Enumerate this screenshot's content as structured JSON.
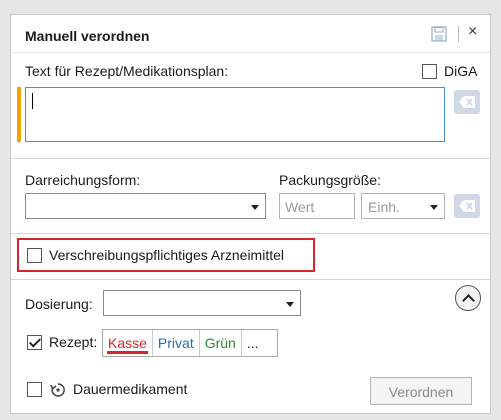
{
  "dialog": {
    "title": "Manuell verordnen",
    "save_icon": "save-icon",
    "close_label": "×"
  },
  "text_section": {
    "label": "Text für Rezept/Medikationsplan:",
    "diga_label": "DiGA",
    "diga_checked": false,
    "text_value": "",
    "clear_icon": "backspace-clear-icon"
  },
  "form_section": {
    "darreichungsform_label": "Darreichungsform:",
    "darreichungsform_value": "",
    "packungsgroesse_label": "Packungsgröße:",
    "wert_placeholder": "Wert",
    "einheit_placeholder": "Einh."
  },
  "prescription_required": {
    "label": "Verschreibungspflichtiges Arzneimittel",
    "checked": false,
    "highlight_color": "#d9262e"
  },
  "dosage": {
    "label": "Dosierung:",
    "value": ""
  },
  "rezept": {
    "label": "Rezept:",
    "checked": true,
    "options": [
      "Kasse",
      "Privat",
      "Grün",
      "..."
    ],
    "selected": "Kasse",
    "colors": {
      "kasse": "#d9262e",
      "privat": "#1f6fb5",
      "gruen": "#2e8b2e"
    }
  },
  "dauermedikament": {
    "label": "Dauermedikament",
    "checked": false,
    "icon": "cycle-icon"
  },
  "actions": {
    "verordnen_label": "Verordnen",
    "verordnen_enabled": false
  },
  "accent_color": "#f0a500"
}
